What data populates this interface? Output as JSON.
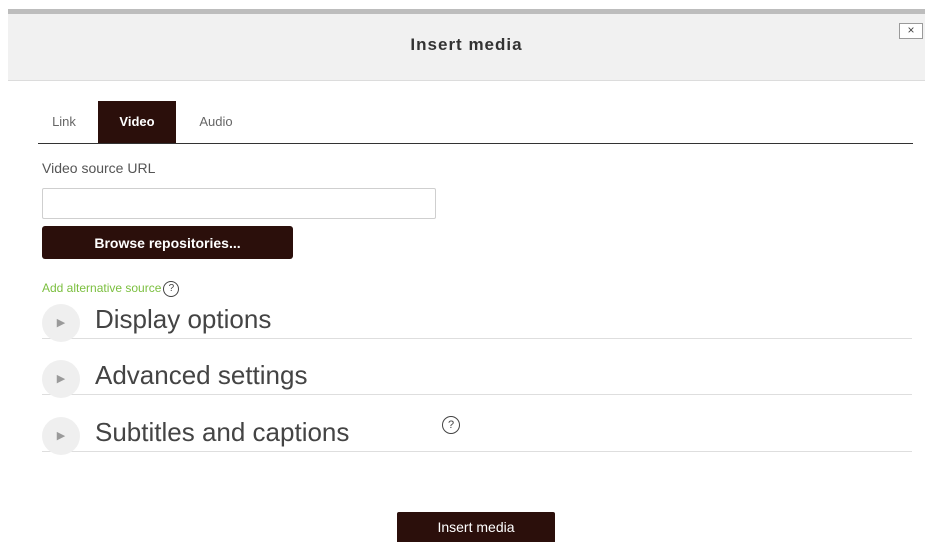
{
  "dialog": {
    "title": "Insert media",
    "close_label": "×"
  },
  "tabs": [
    {
      "label": "Link",
      "active": false
    },
    {
      "label": "Video",
      "active": true
    },
    {
      "label": "Audio",
      "active": false
    }
  ],
  "video": {
    "source_label": "Video source URL",
    "source_value": "",
    "browse_label": "Browse repositories...",
    "add_alternative_label": "Add alternative source"
  },
  "sections": [
    {
      "title": "Display options"
    },
    {
      "title": "Advanced settings"
    },
    {
      "title": "Subtitles and captions"
    }
  ],
  "icons": {
    "help": "question-circle-icon",
    "expand": "chevron-right-icon"
  },
  "footer": {
    "insert_label": "Insert media"
  },
  "colors": {
    "accent": "#2b0f0b",
    "link": "#7bbf3f"
  }
}
